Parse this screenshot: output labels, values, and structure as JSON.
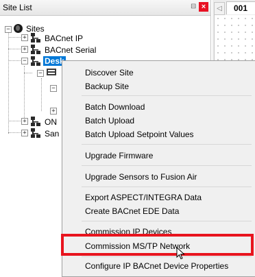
{
  "panel": {
    "title": "Site List",
    "pin_glyph": "⊟",
    "close_glyph": "×"
  },
  "doc_tab": {
    "label": "001",
    "arrow_glyph": "◁"
  },
  "tree": {
    "root": "Sites",
    "nodes": [
      {
        "label": "BACnet IP"
      },
      {
        "label": "BACnet Serial"
      },
      {
        "label": "Desk"
      },
      {
        "label": "ON"
      },
      {
        "label": "San"
      }
    ]
  },
  "context_menu": {
    "items": [
      {
        "label": "Discover Site"
      },
      {
        "label": "Backup Site"
      },
      {
        "label": "Batch Download"
      },
      {
        "label": "Batch Upload"
      },
      {
        "label": "Batch Upload Setpoint Values"
      },
      {
        "label": "Upgrade Firmware"
      },
      {
        "label": "Upgrade Sensors to Fusion Air"
      },
      {
        "label": "Export ASPECT/INTEGRA Data"
      },
      {
        "label": "Create BACnet EDE Data"
      },
      {
        "label": "Commission IP Devices"
      },
      {
        "label": "Commission MS/TP Network"
      },
      {
        "label": "Configure IP BACnet Device Properties"
      }
    ],
    "highlighted": "Commission MS/TP Network",
    "highlight_color": "#e8141e"
  },
  "colors": {
    "selection": "#0078d7",
    "close_button": "#e81123"
  }
}
